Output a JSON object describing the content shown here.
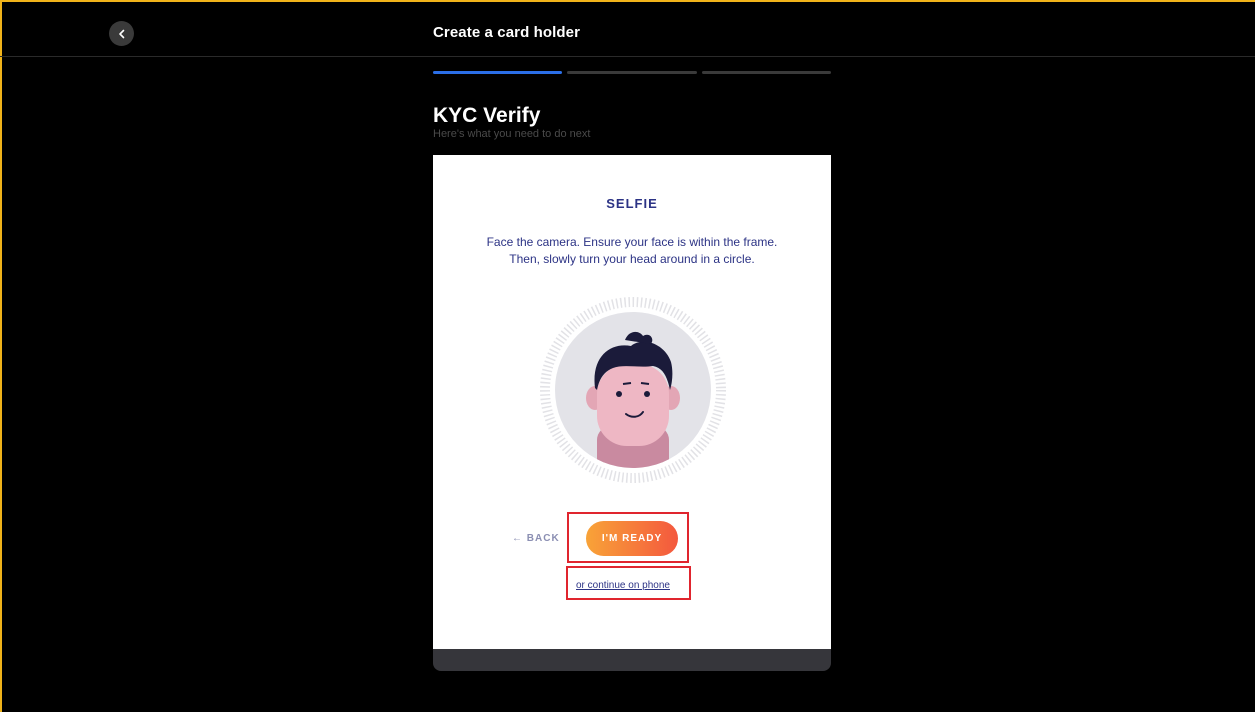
{
  "header": {
    "title": "Create a card holder",
    "back_icon": "chevron-left-icon"
  },
  "progress": {
    "steps_total": 3,
    "current_step": 1,
    "active_color": "#2b6fe8",
    "inactive_color": "#3a3a3a"
  },
  "kyc": {
    "title": "KYC Verify",
    "subtitle": "Here's what you need to do next"
  },
  "card": {
    "section_title": "SELFIE",
    "instruction_line1": "Face the camera. Ensure your face is within the frame.",
    "instruction_line2": "Then, slowly turn your head around in a circle.",
    "illustration_icon": "face-avatar-icon",
    "back_label": "← BACK",
    "ready_label": "I'M READY",
    "phone_link": "or continue on phone"
  },
  "colors": {
    "frame": "#f0b31a",
    "accent_text": "#2c3385",
    "button_gradient_start": "#f8a338",
    "button_gradient_end": "#f4583e",
    "highlight": "#e0252e"
  }
}
